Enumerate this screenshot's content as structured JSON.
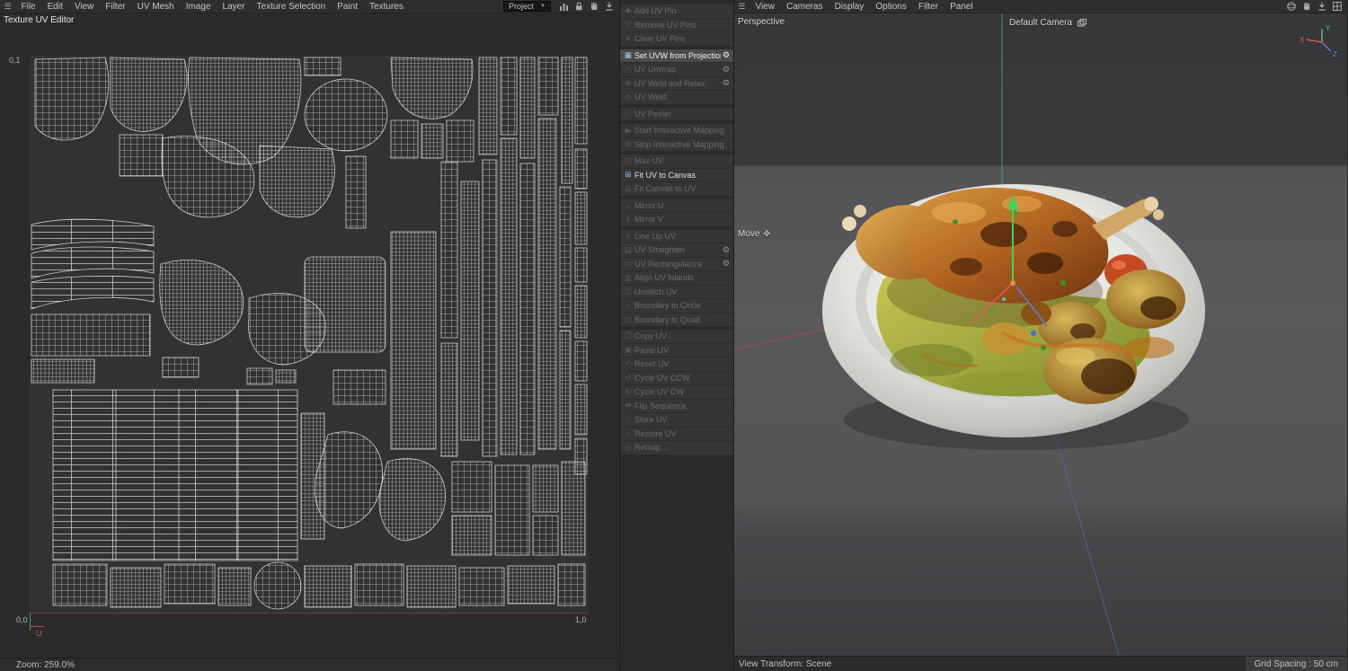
{
  "colors": {
    "axis_x": "#d05858",
    "axis_y": "#58c470",
    "axis_z": "#6080d0",
    "command_highlight": "#4a4a4a"
  },
  "uv_editor": {
    "title": "Texture UV Editor",
    "menu": [
      "File",
      "Edit",
      "View",
      "Filter",
      "UV Mesh",
      "Image",
      "Layer",
      "Texture Selection",
      "Paint",
      "Textures"
    ],
    "project_dropdown": {
      "value": "Project"
    },
    "toolbar_icons": [
      "columns-icon",
      "lock-icon",
      "hand-icon",
      "download-icon"
    ],
    "corner_labels": {
      "top_left": "0,1",
      "bottom_left": "0,0",
      "bottom_right": "1,0"
    },
    "u_axis_label": "U",
    "status": {
      "zoom": "Zoom: 259.0%"
    }
  },
  "uv_commands": {
    "items": [
      {
        "label": "Add UV Pin",
        "icon": "add-uv-pin",
        "glyph": "✚",
        "enabled": false
      },
      {
        "label": "Remove UV Pins",
        "icon": "remove-uv-pins",
        "glyph": "▽",
        "enabled": false
      },
      {
        "label": "Clear UV Pins",
        "icon": "clear-uv-pins",
        "glyph": "✕",
        "enabled": false
      },
      {
        "label": "Set UVW from Projection",
        "icon": "set-uvw-projection",
        "glyph": "▦",
        "enabled": true,
        "active": true,
        "gear": true,
        "sep": true
      },
      {
        "label": "UV Unwrap",
        "icon": "uv-unwrap",
        "glyph": "◰",
        "enabled": false,
        "gear": true
      },
      {
        "label": "UV Weld and Relax",
        "icon": "uv-weld-relax",
        "glyph": "⊕",
        "enabled": false,
        "gear": true
      },
      {
        "label": "UV Weld",
        "icon": "uv-weld",
        "glyph": "⊙",
        "enabled": false
      },
      {
        "label": "UV Peeler",
        "icon": "uv-peeler",
        "glyph": "▷",
        "enabled": false,
        "sep": true
      },
      {
        "label": "Start Interactive Mapping",
        "icon": "start-interactive-mapping",
        "glyph": "▶",
        "enabled": false,
        "sep": true
      },
      {
        "label": "Stop Interactive Mapping",
        "icon": "stop-interactive-mapping",
        "glyph": "⊘",
        "enabled": false
      },
      {
        "label": "Max UV",
        "icon": "max-uv",
        "glyph": "◱",
        "enabled": false,
        "sep": true
      },
      {
        "label": "Fit UV to Canvas",
        "icon": "fit-uv-to-canvas",
        "glyph": "⊞",
        "enabled": true
      },
      {
        "label": "Fit Canvas to UV",
        "icon": "fit-canvas-to-uv",
        "glyph": "⊟",
        "enabled": false
      },
      {
        "label": "Mirror U",
        "icon": "mirror-u",
        "glyph": "⇔",
        "enabled": false,
        "sep": true
      },
      {
        "label": "Mirror V",
        "icon": "mirror-v",
        "glyph": "⇕",
        "enabled": false
      },
      {
        "label": "Line Up UV",
        "icon": "line-up-uv",
        "glyph": "≡",
        "enabled": false,
        "sep": true
      },
      {
        "label": "UV Straighten",
        "icon": "uv-straighten",
        "glyph": "▤",
        "enabled": false,
        "gear": true
      },
      {
        "label": "UV Rectangularize",
        "icon": "uv-rectangularize",
        "glyph": "▭",
        "enabled": false,
        "gear": true
      },
      {
        "label": "Align UV Islands",
        "icon": "align-uv-islands",
        "glyph": "▥",
        "enabled": false
      },
      {
        "label": "Unstitch UV",
        "icon": "unstitch-uv",
        "glyph": "◫",
        "enabled": false
      },
      {
        "label": "Boundary to Circle",
        "icon": "boundary-to-circle",
        "glyph": "○",
        "enabled": false
      },
      {
        "label": "Boundary to Quad",
        "icon": "boundary-to-quad",
        "glyph": "◻",
        "enabled": false
      },
      {
        "label": "Copy UV",
        "icon": "copy-uv",
        "glyph": "❐",
        "enabled": false,
        "sep": true
      },
      {
        "label": "Paste UV",
        "icon": "paste-uv",
        "glyph": "▣",
        "enabled": false
      },
      {
        "label": "Reset UV",
        "icon": "reset-uv",
        "glyph": "↶",
        "enabled": false
      },
      {
        "label": "Cycle UV CCW",
        "icon": "cycle-uv-ccw",
        "glyph": "↺",
        "enabled": false
      },
      {
        "label": "Cycle UV CW",
        "icon": "cycle-uv-cw",
        "glyph": "↻",
        "enabled": false
      },
      {
        "label": "Flip Sequence",
        "icon": "flip-sequence",
        "glyph": "⇄",
        "enabled": false
      },
      {
        "label": "Store UV",
        "icon": "store-uv",
        "glyph": "↓",
        "enabled": false
      },
      {
        "label": "Restore UV",
        "icon": "restore-uv",
        "glyph": "↑",
        "enabled": false
      },
      {
        "label": "Remap...",
        "icon": "remap",
        "glyph": "◇",
        "enabled": false
      }
    ]
  },
  "viewport3d": {
    "menu": [
      "View",
      "Cameras",
      "Display",
      "Options",
      "Filter",
      "Panel"
    ],
    "toolbar_icons": [
      "sphere-icon",
      "hand-icon",
      "download-icon",
      "grid-icon"
    ],
    "view_label": "Perspective",
    "camera_label": "Default Camera",
    "tool_label": "Move",
    "axis": {
      "x": "X",
      "y": "Y",
      "z": "Z"
    },
    "status": {
      "left": "View Transform: Scene",
      "right": "Grid Spacing : 50 cm"
    }
  }
}
